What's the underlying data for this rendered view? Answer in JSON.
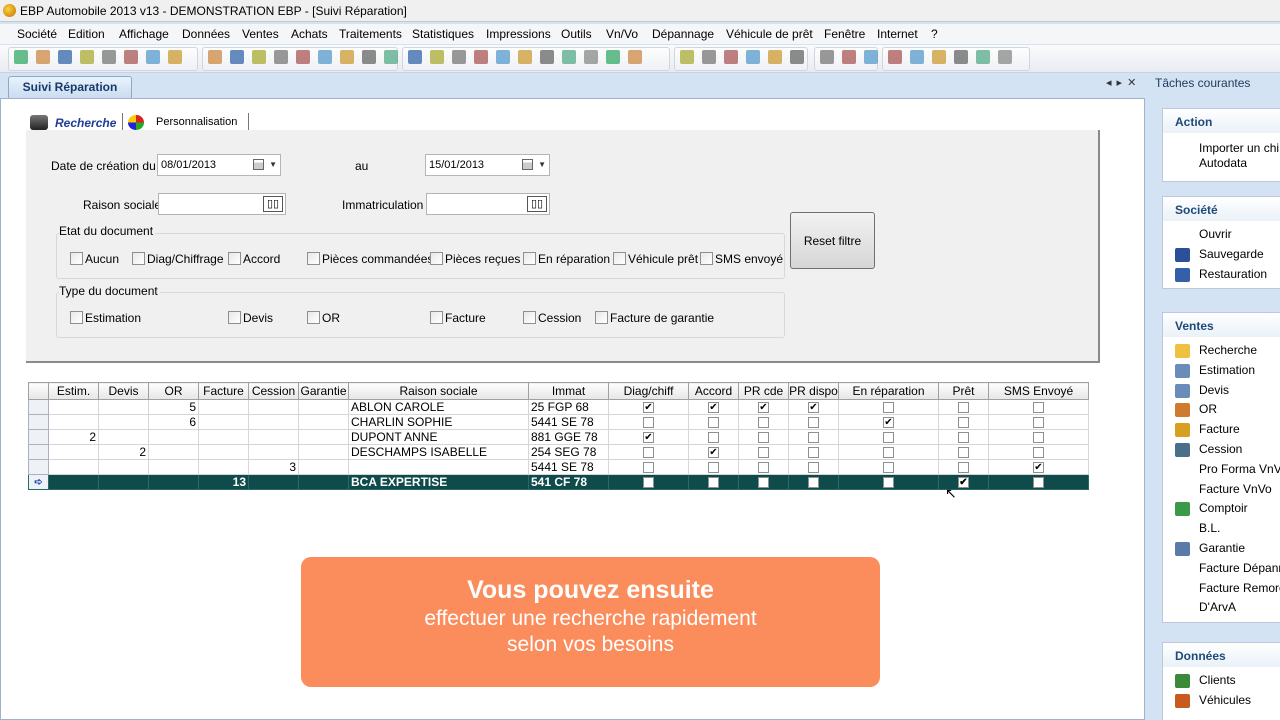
{
  "window": {
    "title": "EBP Automobile 2013 v13 - DEMONSTRATION EBP - [Suivi Réparation]"
  },
  "menu": [
    "Société",
    "Edition",
    "Affichage",
    "Données",
    "Ventes",
    "Achats",
    "Traitements",
    "Statistiques",
    "Impressions",
    "Outils",
    "Vn/Vo",
    "Dépannage",
    "Véhicule de prêt",
    "Fenêtre",
    "Internet",
    "?"
  ],
  "tab": {
    "label": "Suivi Réparation"
  },
  "subtabs": {
    "search": "Recherche",
    "custom": "Personnalisation"
  },
  "filters": {
    "date_label": "Date de création du",
    "date_from": "08/01/2013",
    "date_to_label": "au",
    "date_to": "15/01/2013",
    "company_label": "Raison sociale",
    "plate_label": "Immatriculation",
    "state_title": "Etat du document",
    "states": [
      "Aucun",
      "Diag/Chiffrage",
      "Accord",
      "Pièces commandées",
      "Pièces reçues",
      "En réparation",
      "Véhicule prêt",
      "SMS envoyé"
    ],
    "type_title": "Type du document",
    "types": [
      "Estimation",
      "Devis",
      "OR",
      "Facture",
      "Cession",
      "Facture de garantie"
    ],
    "reset": "Reset filtre"
  },
  "grid": {
    "columns": [
      "Estim.",
      "Devis",
      "OR",
      "Facture",
      "Cession",
      "Garantie",
      "Raison sociale",
      "Immat",
      "Diag/chiff",
      "Accord",
      "PR cde",
      "PR dispo",
      "En réparation",
      "Prêt",
      "SMS Envoyé"
    ],
    "rows": [
      {
        "estim": "",
        "devis": "",
        "or": "5",
        "facture": "",
        "cession": "",
        "garantie": "",
        "name": "ABLON CAROLE",
        "immat": "25 FGP 68",
        "diag": true,
        "accord": true,
        "prcde": true,
        "prdispo": true,
        "rep": false,
        "pret": false,
        "sms": false
      },
      {
        "estim": "",
        "devis": "",
        "or": "6",
        "facture": "",
        "cession": "",
        "garantie": "",
        "name": "CHARLIN SOPHIE",
        "immat": "5441 SE 78",
        "diag": false,
        "accord": false,
        "prcde": false,
        "prdispo": false,
        "rep": true,
        "pret": false,
        "sms": false
      },
      {
        "estim": "2",
        "devis": "",
        "or": "",
        "facture": "",
        "cession": "",
        "garantie": "",
        "name": "DUPONT ANNE",
        "immat": "881 GGE 78",
        "diag": true,
        "accord": false,
        "prcde": false,
        "prdispo": false,
        "rep": false,
        "pret": false,
        "sms": false
      },
      {
        "estim": "",
        "devis": "2",
        "or": "",
        "facture": "",
        "cession": "",
        "garantie": "",
        "name": "DESCHAMPS ISABELLE",
        "immat": "254 SEG 78",
        "diag": false,
        "accord": true,
        "prcde": false,
        "prdispo": false,
        "rep": false,
        "pret": false,
        "sms": false
      },
      {
        "estim": "",
        "devis": "",
        "or": "",
        "facture": "",
        "cession": "3",
        "garantie": "",
        "name": "",
        "immat": "5441 SE 78",
        "diag": false,
        "accord": false,
        "prcde": false,
        "prdispo": false,
        "rep": false,
        "pret": false,
        "sms": true
      },
      {
        "estim": "",
        "devis": "",
        "or": "",
        "facture": "13",
        "cession": "",
        "garantie": "",
        "name": "BCA EXPERTISE",
        "immat": "541 CF 78",
        "diag": false,
        "accord": false,
        "prcde": false,
        "prdispo": false,
        "rep": false,
        "pret": true,
        "sms": false,
        "selected": true
      }
    ]
  },
  "overlay": {
    "headline": "Vous pouvez ensuite",
    "line1": "effectuer une recherche rapidement",
    "line2": "selon vos besoins"
  },
  "taskpane": {
    "title": "Tâches courantes",
    "sections": [
      {
        "title": "Action",
        "items": [
          {
            "label": "Importer un chi",
            "icon": "none"
          },
          {
            "label": "Autodata",
            "icon": "none"
          }
        ]
      },
      {
        "title": "Société",
        "items": [
          {
            "label": "Ouvrir",
            "icon": "none"
          },
          {
            "label": "Sauvegarde",
            "icon": "save-icon"
          },
          {
            "label": "Restauration",
            "icon": "restore-icon"
          }
        ]
      },
      {
        "title": "Ventes",
        "items": [
          {
            "label": "Recherche",
            "icon": "folder-icon"
          },
          {
            "label": "Estimation",
            "icon": "document-icon"
          },
          {
            "label": "Devis",
            "icon": "document-icon"
          },
          {
            "label": "OR",
            "icon": "edit-document-icon"
          },
          {
            "label": "Facture",
            "icon": "invoice-icon"
          },
          {
            "label": "Cession",
            "icon": "transfer-icon"
          },
          {
            "label": "Pro Forma VnVo",
            "icon": "none"
          },
          {
            "label": "Facture VnVo",
            "icon": "none"
          },
          {
            "label": "Comptoir",
            "icon": "counter-icon"
          },
          {
            "label": "B.L.",
            "icon": "none"
          },
          {
            "label": "Garantie",
            "icon": "warranty-icon"
          },
          {
            "label": "Facture Dépann",
            "icon": "none"
          },
          {
            "label": "Facture Remorc",
            "icon": "none"
          },
          {
            "label": "D'ArvA",
            "icon": "none"
          }
        ]
      },
      {
        "title": "Données",
        "items": [
          {
            "label": "Clients",
            "icon": "client-icon"
          },
          {
            "label": "Véhicules",
            "icon": "vehicle-icon"
          }
        ]
      }
    ]
  },
  "colors": {
    "selected_row": "#0f4b4a",
    "overlay": "#fb8c5c",
    "accent": "#1e4a7a"
  }
}
